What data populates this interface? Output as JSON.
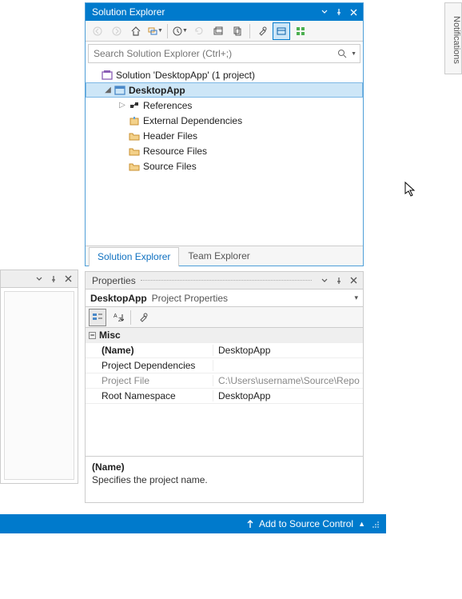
{
  "notifications_label": "Notifications",
  "solution_explorer": {
    "title": "Solution Explorer",
    "search_placeholder": "Search Solution Explorer (Ctrl+;)",
    "solution_label": "Solution 'DesktopApp' (1 project)",
    "project_label": "DesktopApp",
    "nodes": {
      "references": "References",
      "ext_deps": "External Dependencies",
      "header_files": "Header Files",
      "resource_files": "Resource Files",
      "source_files": "Source Files"
    },
    "tabs": {
      "sol": "Solution Explorer",
      "team": "Team Explorer"
    }
  },
  "properties": {
    "title": "Properties",
    "selector_name": "DesktopApp",
    "selector_type": "Project Properties",
    "category": "Misc",
    "rows": {
      "name_k": "(Name)",
      "name_v": "DesktopApp",
      "deps_k": "Project Dependencies",
      "deps_v": "",
      "file_k": "Project File",
      "file_v": "C:\\Users\\username\\Source\\Repo",
      "ns_k": "Root Namespace",
      "ns_v": "DesktopApp"
    },
    "desc_name": "(Name)",
    "desc_text": "Specifies the project name."
  },
  "statusbar": {
    "add_sc": "Add to Source Control"
  }
}
